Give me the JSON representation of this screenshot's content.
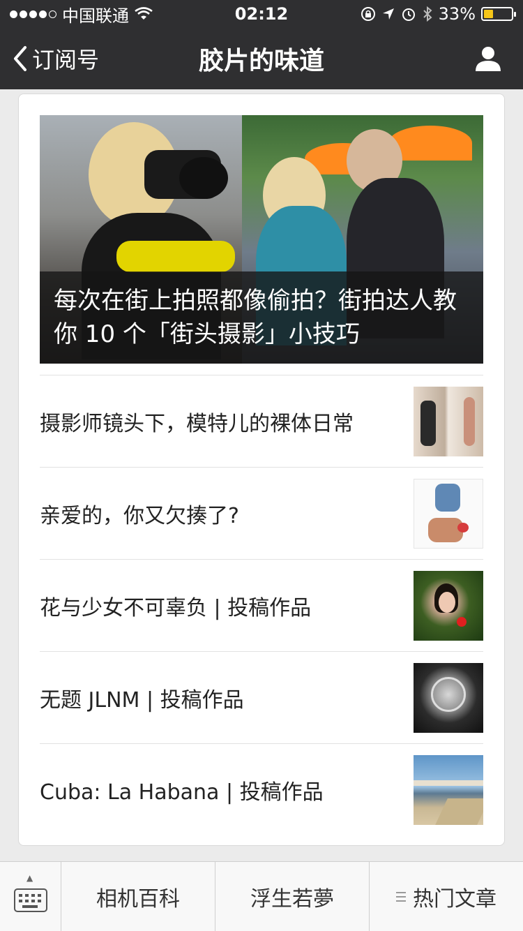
{
  "status_bar": {
    "carrier": "中国联通",
    "time": "02:12",
    "battery_percent": "33%",
    "battery_level": 0.33,
    "icons": [
      "signal-icon",
      "wifi-icon",
      "rotation-lock-icon",
      "location-icon",
      "alarm-icon",
      "bluetooth-icon",
      "battery-icon"
    ],
    "battery_color": "#f5c518"
  },
  "nav": {
    "back_label": "订阅号",
    "title": "胶片的味道",
    "bg_color": "#2f2f31"
  },
  "hero": {
    "caption": "每次在街上拍照都像偷拍？街拍达人教你 10 个「街头摄影」小技巧"
  },
  "articles": [
    {
      "title": "摄影师镜头下，模特儿的裸体日常"
    },
    {
      "title": "亲爱的，你又欠揍了?"
    },
    {
      "title": "花与少女不可辜负 | 投稿作品"
    },
    {
      "title": "无题 JLNM | 投稿作品"
    },
    {
      "title": "Cuba: La Habana | 投稿作品"
    }
  ],
  "bottom_menu": {
    "items": [
      {
        "label": "相机百科"
      },
      {
        "label": "浮生若夢"
      },
      {
        "label": "热门文章"
      }
    ]
  }
}
